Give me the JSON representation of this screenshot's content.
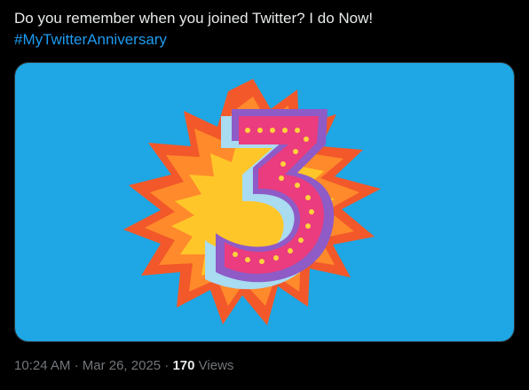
{
  "tweet": {
    "text": "Do you remember when you joined Twitter? I do Now!",
    "hashtag": "#MyTwitterAnniversary",
    "media": {
      "image_name": "twitter-anniversary-number-3-illustration",
      "number": "3",
      "background_color": "#1ea7e4"
    },
    "time": "10:24 AM",
    "separator": "·",
    "date": "Mar 26, 2025",
    "views_count": "170",
    "views_label": "Views"
  }
}
